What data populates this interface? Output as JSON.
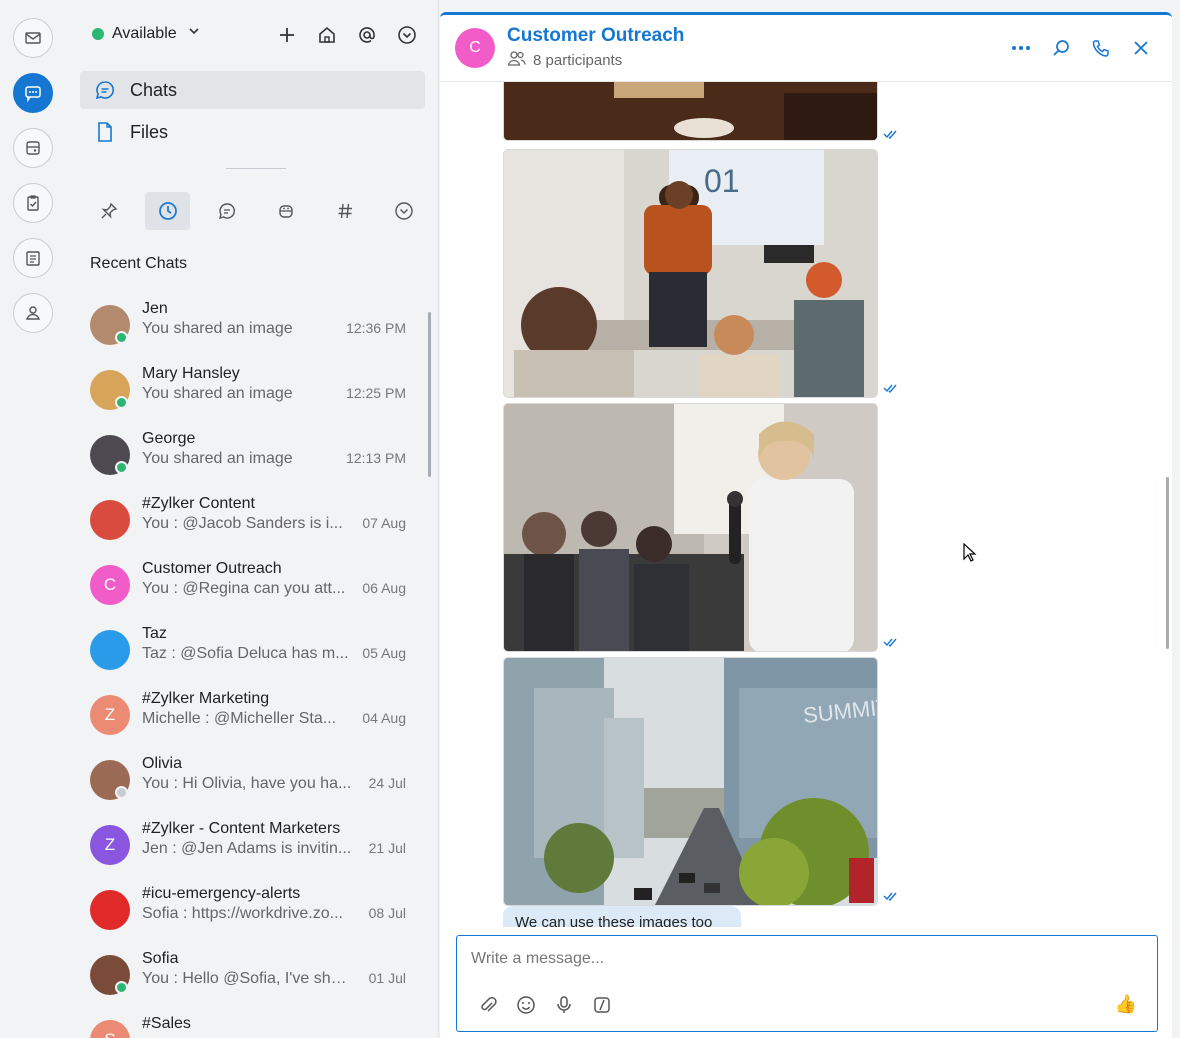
{
  "presence": {
    "status": "Available"
  },
  "nav": {
    "chats": "Chats",
    "files": "Files"
  },
  "recent_chats_title": "Recent Chats",
  "chats": [
    {
      "name": "Jen",
      "message": "You shared an image",
      "time": "12:36 PM",
      "avatar_color": "#b48a6e",
      "avatar_letter": "",
      "online": true
    },
    {
      "name": "Mary Hansley",
      "message": "You shared an image",
      "time": "12:25 PM",
      "avatar_color": "#d6a55a",
      "avatar_letter": "",
      "online": true
    },
    {
      "name": "George",
      "message": "You shared an image",
      "time": "12:13 PM",
      "avatar_color": "#4c4a50",
      "avatar_letter": "",
      "online": true
    },
    {
      "name": "#Zylker Content",
      "message": "You : @Jacob Sanders  is i...",
      "time": "07 Aug",
      "avatar_color": "#d94b3f",
      "avatar_letter": "",
      "online": false
    },
    {
      "name": "Customer Outreach",
      "message": "You : @Regina can you att...",
      "time": "06 Aug",
      "avatar_color": "#f25cc8",
      "avatar_letter": "C",
      "online": false
    },
    {
      "name": "Taz",
      "message": "Taz : @Sofia Deluca has m...",
      "time": "05 Aug",
      "avatar_color": "#2a9be8",
      "avatar_letter": "",
      "online": false
    },
    {
      "name": "#Zylker Marketing",
      "message": "Michelle : @Micheller Sta...",
      "time": "04 Aug",
      "avatar_color": "#ec8b73",
      "avatar_letter": "Z",
      "online": false
    },
    {
      "name": "Olivia",
      "message": "You : Hi Olivia, have you ha...",
      "time": "24 Jul",
      "avatar_color": "#9a6a55",
      "avatar_letter": "",
      "online": false,
      "offline_dot": true
    },
    {
      "name": "#Zylker - Content Marketers",
      "message": "Jen : @Jen Adams  is invitin...",
      "time": "21 Jul",
      "avatar_color": "#8a56e0",
      "avatar_letter": "Z",
      "online": false
    },
    {
      "name": "#icu-emergency-alerts",
      "message": "Sofia : https://workdrive.zo...",
      "time": "08 Jul",
      "avatar_color": "#e02a2a",
      "avatar_letter": "",
      "online": false
    },
    {
      "name": "Sofia",
      "message": "You : Hello @Sofia, I've shar...",
      "time": "01 Jul",
      "avatar_color": "#7b4b3a",
      "avatar_letter": "",
      "online": true
    },
    {
      "name": "#Sales",
      "message": "",
      "time": "",
      "avatar_color": "#ec8b73",
      "avatar_letter": "S",
      "online": false
    }
  ],
  "conversation": {
    "avatar_letter": "C",
    "title": "Customer Outreach",
    "participants": "8 participants",
    "last_message": "We can use these images too",
    "composer_placeholder": "Write a message..."
  },
  "colors": {
    "accent": "#1677d2",
    "online": "#2bb673",
    "channel_avatar": "#f25cc8"
  }
}
